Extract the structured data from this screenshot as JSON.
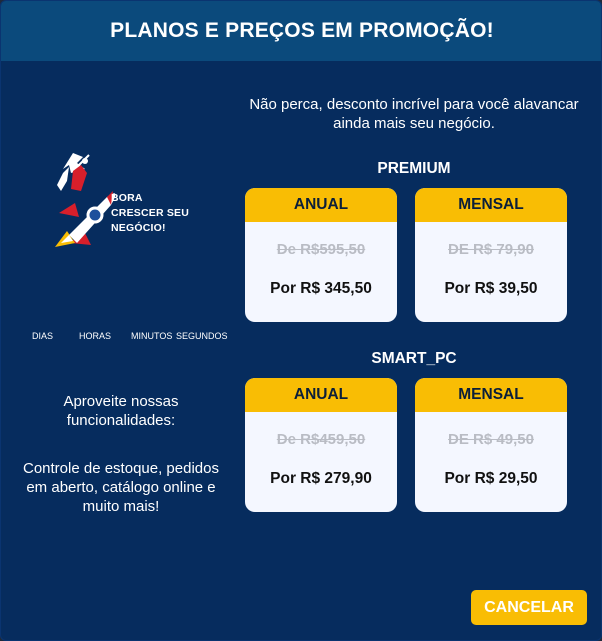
{
  "header": {
    "title": "PLANOS E PREÇOS EM PROMOÇÃO!"
  },
  "logo": {
    "lines": [
      "BORA",
      "CRESCER SEU",
      "NEGÓCIO!"
    ]
  },
  "countdown": {
    "labels": [
      "DIAS",
      "HORAS",
      "MINUTOS",
      "SEGUNDOS"
    ]
  },
  "left": {
    "text1": "Aproveite nossas funcionalidades:",
    "text2": "Controle de estoque, pedidos em aberto, catálogo online e muito mais!"
  },
  "intro": "Não perca, desconto incrível para você alavancar ainda mais seu negócio.",
  "plans": [
    {
      "name": "PREMIUM",
      "options": [
        {
          "period": "ANUAL",
          "old": "De R$595,50",
          "new": "Por R$ 345,50"
        },
        {
          "period": "MENSAL",
          "old": "DE R$ 79,90",
          "new": "Por R$ 39,50"
        }
      ]
    },
    {
      "name": "SMART_PC",
      "options": [
        {
          "period": "ANUAL",
          "old": "De R$459,50",
          "new": "Por R$ 279,90"
        },
        {
          "period": "MENSAL",
          "old": "DE R$ 49,50",
          "new": "Por R$ 29,50"
        }
      ]
    }
  ],
  "actions": {
    "cancel": "CANCELAR"
  },
  "colors": {
    "background": "#062c5e",
    "header": "#0b4a7c",
    "accent": "#f9bd04",
    "rocket_red": "#d71f2b"
  }
}
